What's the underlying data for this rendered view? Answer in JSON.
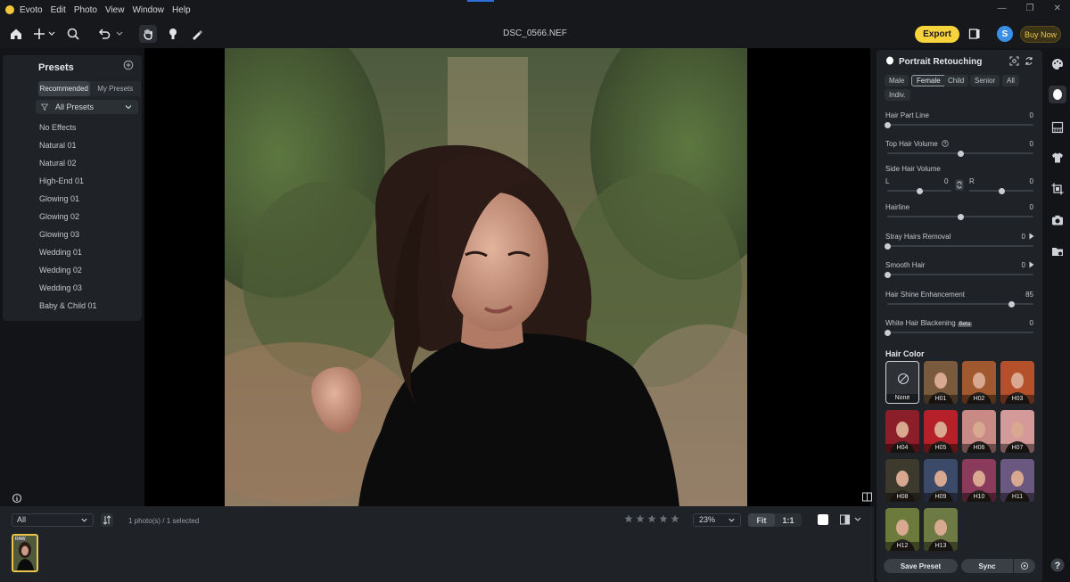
{
  "menu": {
    "app": "Evoto",
    "items": [
      "Edit",
      "Photo",
      "View",
      "Window",
      "Help"
    ]
  },
  "toolbar": {
    "filename": "DSC_0566.NEF",
    "export_label": "Export",
    "user_initial": "S",
    "buy_label": "Buy Now"
  },
  "presets": {
    "title": "Presets",
    "tabs": [
      "Recommended",
      "My Presets"
    ],
    "active_tab": "Recommended",
    "filter_value": "All Presets",
    "items": [
      "No Effects",
      "Natural 01",
      "Natural 02",
      "High-End 01",
      "Glowing 01",
      "Glowing 02",
      "Glowing 03",
      "Wedding 01",
      "Wedding 02",
      "Wedding 03",
      "Baby & Child 01"
    ]
  },
  "bottom": {
    "filter_value": "All",
    "count_text": "1 photo(s) / 1 selected",
    "zoom_value": "23%",
    "fit_label": "Fit",
    "one_to_one_label": "1:1",
    "thumb_badge": "RAW"
  },
  "retouch": {
    "title": "Portrait Retouching",
    "chips": [
      "Male",
      "Female",
      "Child",
      "Senior",
      "All",
      "Indiv."
    ],
    "active_chip": "Female",
    "sliders": [
      {
        "label": "Hair Part Line",
        "value": "0",
        "level": 0
      },
      {
        "label": "Top Hair Volume",
        "value": "0",
        "level": 0.5
      },
      {
        "label": "Hairline",
        "value": "0",
        "level": 0.5
      },
      {
        "label": "Stray Hairs Removal",
        "value": "0",
        "level": 0
      },
      {
        "label": "Smooth Hair",
        "value": "0",
        "level": 0
      },
      {
        "label": "Hair Shine Enhancement",
        "value": "85",
        "level": 0.85
      },
      {
        "label": "White Hair Blackening",
        "value": "0",
        "level": 0
      }
    ],
    "side_hair": {
      "label": "Side Hair Volume",
      "left_label": "L",
      "left_value": "0",
      "right_label": "R",
      "right_value": "0"
    },
    "beta_label": "Beta",
    "hair_color_title": "Hair Color",
    "swatches": [
      {
        "label": "None",
        "color": "#2e3237"
      },
      {
        "label": "H01",
        "color": "#7a5a3c"
      },
      {
        "label": "H02",
        "color": "#a0582e"
      },
      {
        "label": "H03",
        "color": "#b4502a"
      },
      {
        "label": "H04",
        "color": "#8a1f2a"
      },
      {
        "label": "H05",
        "color": "#b52128"
      },
      {
        "label": "H06",
        "color": "#c98a86"
      },
      {
        "label": "H07",
        "color": "#d49a9a"
      },
      {
        "label": "H08",
        "color": "#3b3a2c"
      },
      {
        "label": "H09",
        "color": "#3c4a6a"
      },
      {
        "label": "H10",
        "color": "#8a3a5a"
      },
      {
        "label": "H11",
        "color": "#6a5880"
      },
      {
        "label": "H12",
        "color": "#6c7a3c"
      },
      {
        "label": "H13",
        "color": "#6d7a44"
      }
    ],
    "save_label": "Save Preset",
    "sync_label": "Sync"
  },
  "colors": {
    "accent": "#f7d33c",
    "panel": "#1f2226",
    "background": "#121417"
  }
}
